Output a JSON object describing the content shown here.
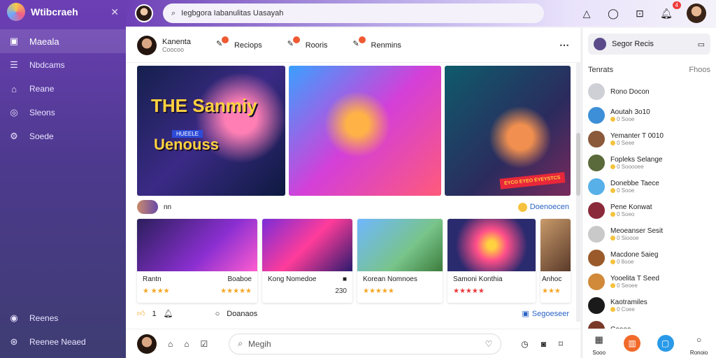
{
  "app": {
    "name": "Wtibcraeh"
  },
  "sidebar": {
    "items": [
      {
        "label": "Maeala",
        "icon": "square-icon"
      },
      {
        "label": "Nbdcams",
        "icon": "list-icon"
      },
      {
        "label": "Reane",
        "icon": "home-icon"
      },
      {
        "label": "Sleons",
        "icon": "check-icon"
      },
      {
        "label": "Soede",
        "icon": "settings-icon"
      }
    ],
    "footer": [
      {
        "label": "Reenes",
        "icon": "chat-icon"
      },
      {
        "label": "Reenee Neaed",
        "icon": "gear-icon"
      }
    ]
  },
  "topbar": {
    "search_text": "Iegbgora Iabanulitas Uasayah",
    "badge_count": "4"
  },
  "stories": {
    "user": {
      "title": "Kanenta",
      "sub": "Coocoo"
    },
    "items": [
      {
        "label": "Reciops"
      },
      {
        "label": "Rooris"
      },
      {
        "label": "Renmins"
      }
    ]
  },
  "hero": {
    "title": "THE Sanmiy",
    "subtitle": "HUEELE",
    "title2": "Uenouss",
    "sticker": "EYCO EYEO EYEYSTCS"
  },
  "meta": {
    "left": "nn",
    "right": "Doenoecen"
  },
  "thumbnails": [
    {
      "name": "Rantn",
      "right": "",
      "stars": "★ ★★★",
      "count": ""
    },
    {
      "name": "Boaboe",
      "right": "",
      "stars": "★★★★★",
      "count": ""
    },
    {
      "name": "Kong Nomedoe",
      "right": "■",
      "stars": "",
      "count": "230"
    },
    {
      "name": "Korean Nomnoes",
      "right": "",
      "stars": "★★★★★",
      "count": ""
    },
    {
      "name": "Samoni Konthia",
      "right": "",
      "stars": "★★★★★",
      "count": ""
    },
    {
      "name": "Anhoc",
      "right": "",
      "stars": "★★★",
      "count": ""
    }
  ],
  "actions": {
    "count": "1",
    "comment": "Doanaos",
    "right": "Segoeseer"
  },
  "bottom": {
    "search_placeholder": "Megih"
  },
  "right_panel": {
    "header": "Segor Recis",
    "title": "Tenrats",
    "title_right": "Fhoos",
    "contacts": [
      {
        "name": "Rono Docon",
        "status": "",
        "color": "#cfcfd6"
      },
      {
        "name": "Aoutah 3o10",
        "status": "0 Sooe",
        "color": "#3d8fd8"
      },
      {
        "name": "Yemanter T 0010",
        "status": "0 Seee",
        "color": "#8a5a3a"
      },
      {
        "name": "Fopleks Selange",
        "status": "0 Sooooee",
        "color": "#5a6a3a"
      },
      {
        "name": "Donebbe Taece",
        "status": "0 Sooe",
        "color": "#58b0e8"
      },
      {
        "name": "Pene Konwat",
        "status": "0 Soeo",
        "color": "#8a2a3a"
      },
      {
        "name": "Meoeanser Sesit",
        "status": "0 Sioooe",
        "color": "#c9c9c9"
      },
      {
        "name": "Macdone 5aieg",
        "status": "0 8ooe",
        "color": "#9a5a2a"
      },
      {
        "name": "Yooelita T Seed",
        "status": "0 Seoee",
        "color": "#d08a3a"
      },
      {
        "name": "Kaotramiles",
        "status": "0 Coee",
        "color": "#1a1a1a"
      },
      {
        "name": "Coooo",
        "status": "",
        "color": "#7a3a2a"
      }
    ],
    "bottom": [
      {
        "label": "Sooo",
        "icon": "calendar-icon",
        "color": "#ffffff"
      },
      {
        "label": "",
        "icon": "orange-icon",
        "color": "#f26a2a"
      },
      {
        "label": "",
        "icon": "blue-icon",
        "color": "#2a9ae8"
      },
      {
        "label": "Ronoio",
        "icon": "circle-icon",
        "color": "#ffffff"
      }
    ]
  }
}
